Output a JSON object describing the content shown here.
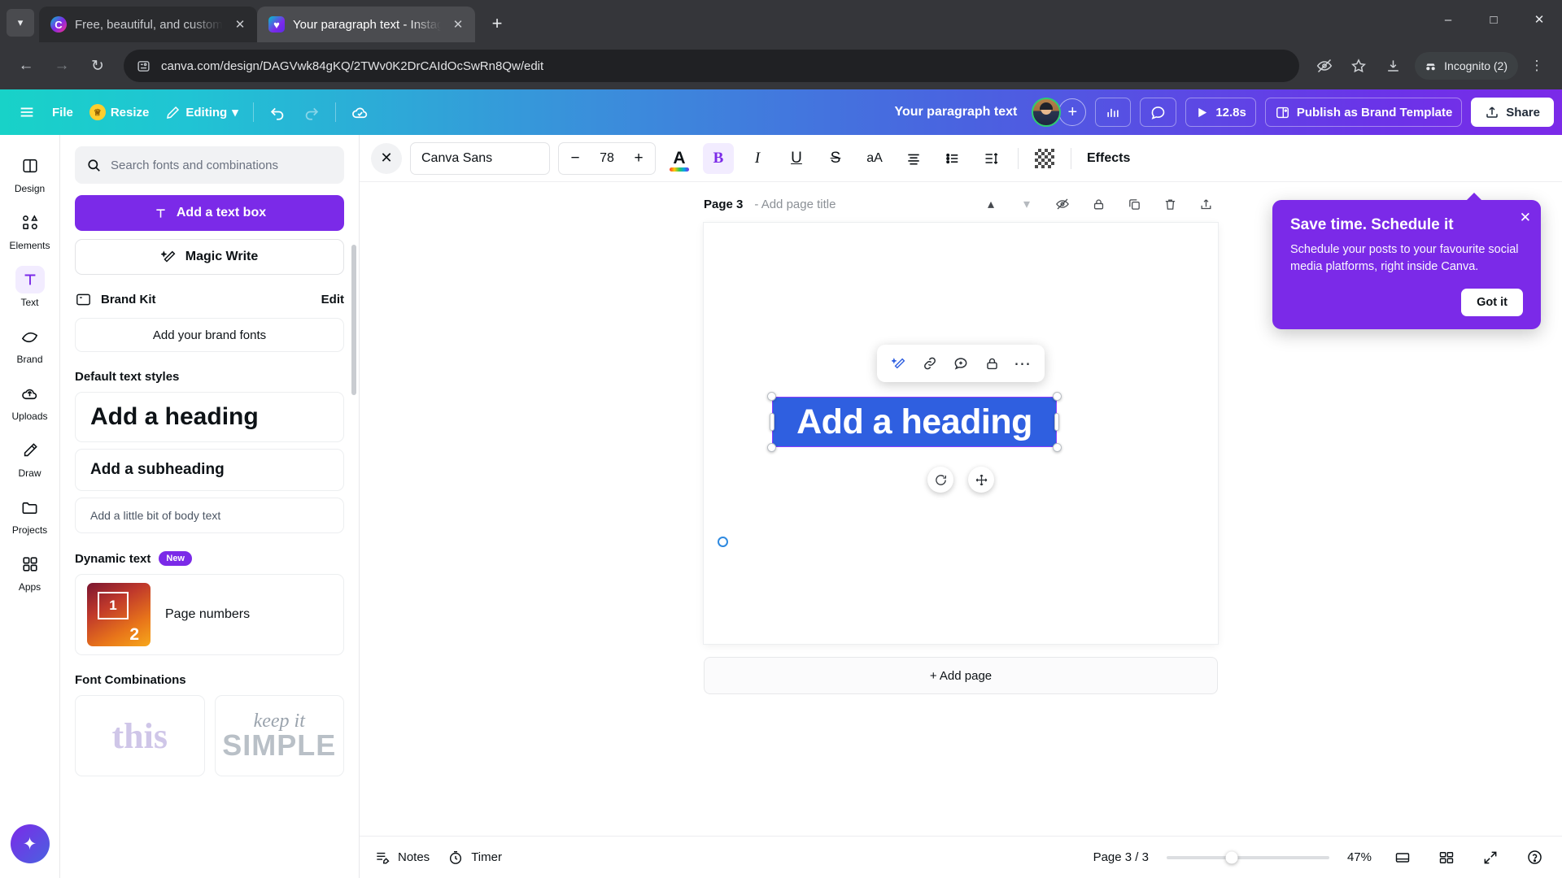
{
  "browser": {
    "tabs": [
      {
        "title": "Free, beautiful, and customizab",
        "favicon": "canva-favicon",
        "active": false
      },
      {
        "title": "Your paragraph text - Instagram",
        "favicon": "canva-doc-favicon",
        "active": true
      }
    ],
    "new_tab_label": "+",
    "tab_list_icon": "chevron-down-icon",
    "window_controls": {
      "minimize": "–",
      "maximize": "□",
      "close": "✕"
    },
    "nav": {
      "back": "←",
      "forward": "→",
      "reload": "↻"
    },
    "url": "canva.com/design/DAGVwk84gKQ/2TWv0K2DrCAIdOcSwRn8Qw/edit",
    "site_icon": "site-settings-icon",
    "actions": {
      "hide_password": "eye-off-icon",
      "bookmark": "star-icon",
      "download": "download-icon",
      "menu": "kebab-menu-icon"
    },
    "incognito_label": "Incognito (2)"
  },
  "canva_header": {
    "menu_icon": "hamburger-menu-icon",
    "file_label": "File",
    "resize_label": "Resize",
    "editing_label": "Editing",
    "undo_icon": "undo-icon",
    "redo_icon": "redo-icon",
    "cloud_icon": "cloud-sync-icon",
    "doc_title": "Your paragraph text",
    "add_collaborator": "+",
    "insights_icon": "bar-chart-icon",
    "comment_icon": "comment-icon",
    "present_label": "12.8s",
    "publish_label": "Publish as Brand Template",
    "share_label": "Share"
  },
  "rail": {
    "items": [
      {
        "label": "Design",
        "icon": "design-layout-icon",
        "active": false
      },
      {
        "label": "Elements",
        "icon": "shapes-icon",
        "active": false
      },
      {
        "label": "Text",
        "icon": "text-T-icon",
        "active": true
      },
      {
        "label": "Brand",
        "icon": "brand-icon",
        "active": false
      },
      {
        "label": "Uploads",
        "icon": "uploads-cloud-icon",
        "active": false
      },
      {
        "label": "Draw",
        "icon": "draw-pen-icon",
        "active": false
      },
      {
        "label": "Projects",
        "icon": "projects-folder-icon",
        "active": false
      },
      {
        "label": "Apps",
        "icon": "apps-grid-icon",
        "active": false
      }
    ],
    "ai_button_icon": "magic-sparkle-icon"
  },
  "panel": {
    "search_placeholder": "Search fonts and combinations",
    "search_value": "",
    "search_icon": "search-icon",
    "add_text_box_label": "Add a text box",
    "add_text_box_icon": "text-T-icon",
    "magic_write_label": "Magic Write",
    "magic_write_icon": "magic-wand-icon",
    "brand_kit_label": "Brand Kit",
    "brand_kit_icon": "brand-kit-icon",
    "brand_kit_edit_label": "Edit",
    "add_brand_fonts_label": "Add your brand fonts",
    "default_text_styles_title": "Default text styles",
    "styles": [
      {
        "label": "Add a heading",
        "kind": "heading"
      },
      {
        "label": "Add a subheading",
        "kind": "subheading"
      },
      {
        "label": "Add a little bit of body text",
        "kind": "body"
      }
    ],
    "dynamic_text_title": "Dynamic text",
    "dynamic_text_badge": "New",
    "page_numbers_label": "Page numbers",
    "page_numbers_thumb_1": "1",
    "page_numbers_thumb_2": "2",
    "font_combinations_title": "Font Combinations",
    "combo_1_text": "this",
    "combo_2_line1": "keep it",
    "combo_2_line2": "SIMPLE"
  },
  "text_toolbar": {
    "close_icon": "close-icon",
    "font_family": "Canva Sans",
    "font_size": "78",
    "size_minus": "−",
    "size_plus": "+",
    "color_icon": "font-color-A-icon",
    "bold_label": "B",
    "italic_label": "I",
    "underline_label": "U",
    "strikethrough_label": "S",
    "case_label": "aA",
    "align_icon": "align-center-icon",
    "list_icon": "bullet-list-icon",
    "spacing_icon": "line-spacing-icon",
    "transparency_icon": "transparency-checker-icon",
    "effects_label": "Effects",
    "bold_active": true
  },
  "canvas": {
    "page_label": "Page 3",
    "page_title_placeholder": "- Add page title",
    "collapse_icon": "chevron-up-icon",
    "expand_icon": "chevron-down-icon",
    "hide_icon": "eye-off-icon",
    "lock_icon": "lock-icon",
    "duplicate_icon": "duplicate-icon",
    "delete_icon": "trash-icon",
    "export_icon": "share-out-icon",
    "selected_text": "Add a heading",
    "float_toolbar": {
      "magic_icon": "magic-edit-icon",
      "link_icon": "link-icon",
      "comment_icon": "comment-add-icon",
      "lock_icon": "lock-icon",
      "more_icon": "more-dots-icon"
    },
    "rotate_icon": "rotate-icon",
    "move_icon": "move-icon",
    "add_page_label": "+ Add page"
  },
  "tooltip": {
    "title": "Save time. Schedule it",
    "body": "Schedule your posts to your favourite social media platforms, right inside Canva.",
    "button_label": "Got it",
    "close_icon": "close-icon",
    "color": "#7b2ae8"
  },
  "bottom_bar": {
    "notes_label": "Notes",
    "notes_icon": "notes-icon",
    "timer_label": "Timer",
    "timer_icon": "timer-icon",
    "page_indicator": "Page 3 / 3",
    "zoom_level": "47%",
    "grid_view_icon": "grid-view-icon",
    "pages_view_icon": "pages-view-icon",
    "fullscreen_icon": "fullscreen-icon",
    "help_icon": "help-icon"
  },
  "colors": {
    "brand_purple": "#7b2ae8",
    "selection_blue": "#2f5fe0",
    "selection_border": "#8b3dff"
  }
}
